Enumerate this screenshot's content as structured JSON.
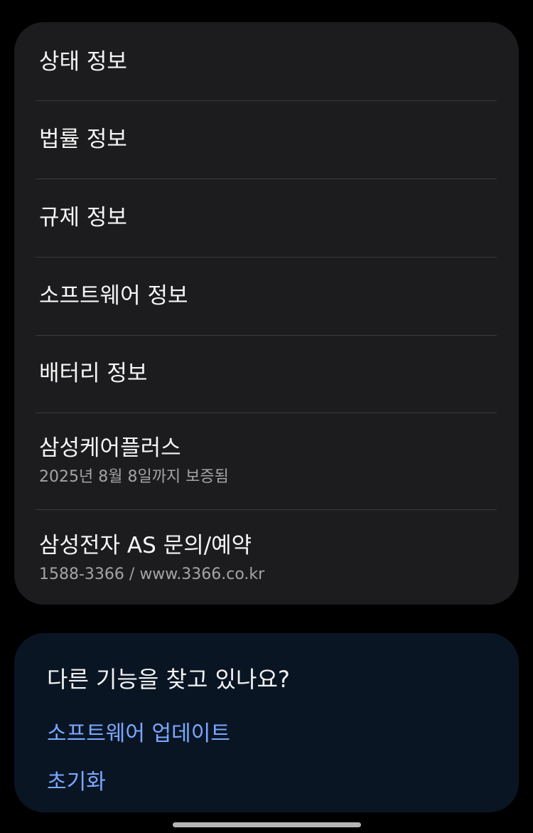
{
  "info_menu": {
    "items": [
      {
        "label": "상태 정보"
      },
      {
        "label": "법률 정보"
      },
      {
        "label": "규제 정보"
      },
      {
        "label": "소프트웨어 정보"
      },
      {
        "label": "배터리 정보"
      },
      {
        "label": "삼성케어플러스",
        "subtitle": "2025년 8월 8일까지 보증됨"
      },
      {
        "label": "삼성전자 AS 문의/예약",
        "subtitle": "1588-3366 / www.3366.co.kr"
      }
    ]
  },
  "suggestions": {
    "title": "다른 기능을 찾고 있나요?",
    "links": [
      {
        "label": "소프트웨어 업데이트"
      },
      {
        "label": "초기화"
      }
    ]
  },
  "colors": {
    "background": "#000000",
    "card": "#1c1c1e",
    "suggestion_card": "#0a1524",
    "link": "#7aa8ff",
    "text_primary": "#f5f5f5",
    "text_secondary": "#a4a4a6"
  }
}
